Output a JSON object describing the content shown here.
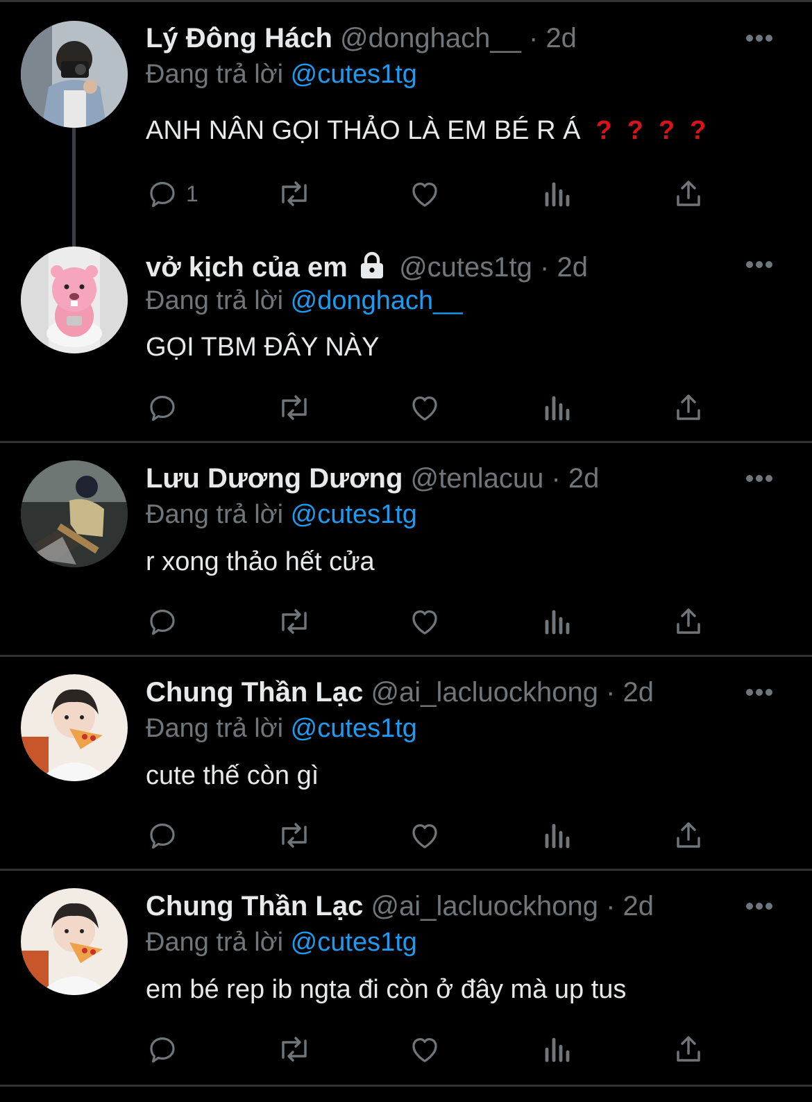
{
  "colors": {
    "background": "#000000",
    "text": "#e7e9ea",
    "muted": "#71767b",
    "link": "#1d9bf0",
    "divider": "#2f3336",
    "question_red": "#d7141c"
  },
  "tweets": [
    {
      "name": "Lý Đông Hách",
      "handle": "@donghach__",
      "separator": "·",
      "time": "2d",
      "reply_prefix": "Đang trả lời",
      "reply_to": "@cutes1tg",
      "text": "ANH NÂN GỌI THẢO LÀ EM BÉ R Á",
      "question_marks": [
        "?",
        "?",
        "?",
        "?"
      ],
      "reply_count": "1"
    },
    {
      "name": "vở kịch của em",
      "handle": "@cutes1tg",
      "separator": "·",
      "time": "2d",
      "reply_prefix": "Đang trả lời",
      "reply_to": "@donghach__",
      "text": "GỌI TBM ĐÂY NÀY",
      "icons": [
        "lock-icon"
      ]
    },
    {
      "name": "Lưu Dương Dương",
      "handle": "@tenlacuu",
      "separator": "·",
      "time": "2d",
      "reply_prefix": "Đang trả lời",
      "reply_to": "@cutes1tg",
      "text": "r xong thảo hết cửa"
    },
    {
      "name": "Chung Thần Lạc",
      "handle": "@ai_lacluockhong",
      "separator": "·",
      "time": "2d",
      "reply_prefix": "Đang trả lời",
      "reply_to": "@cutes1tg",
      "text": "cute thế còn gì"
    },
    {
      "name": "Chung Thần Lạc",
      "handle": "@ai_lacluockhong",
      "separator": "·",
      "time": "2d",
      "reply_prefix": "Đang trả lời",
      "reply_to": "@cutes1tg",
      "text": "em bé rep ib ngta đi còn ở đây mà up tus"
    }
  ],
  "action_icons": [
    "reply-icon",
    "retweet-icon",
    "like-icon",
    "views-icon",
    "share-icon"
  ]
}
